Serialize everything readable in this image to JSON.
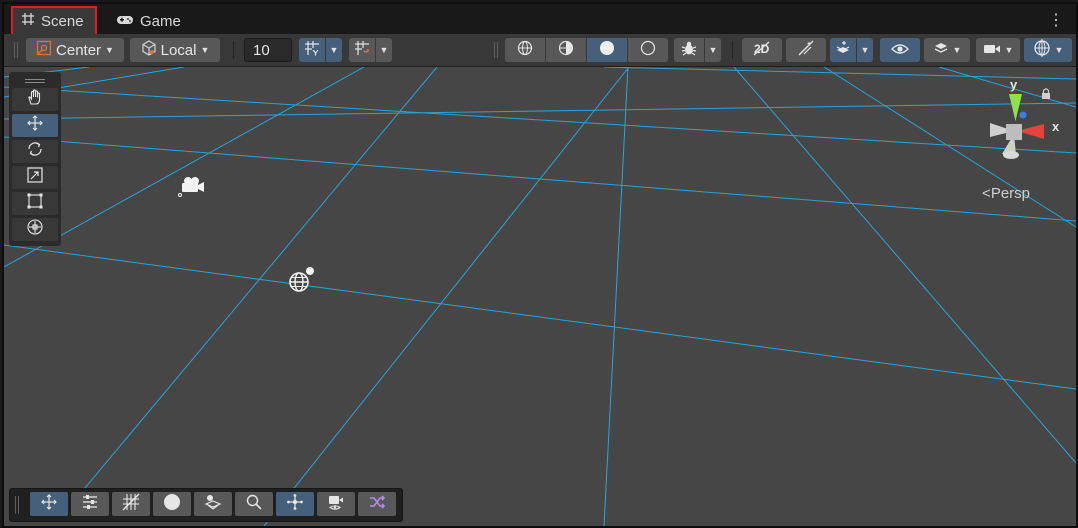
{
  "tabs": [
    {
      "label": "Scene",
      "icon": "grid-hash-icon",
      "active": true
    },
    {
      "label": "Game",
      "icon": "gamepad-icon",
      "active": false
    }
  ],
  "toolbar": {
    "pivot_mode": "Center",
    "pivot_rotation": "Local",
    "grid_size_value": "10"
  },
  "gizmo": {
    "y_label": "y",
    "x_label": "x",
    "projection": "Persp"
  },
  "colors": {
    "accent_blue": "#46607c",
    "grid_line": "#26aee8",
    "viewport_bg": "#464646",
    "tab_highlight": "#e01d1d"
  }
}
